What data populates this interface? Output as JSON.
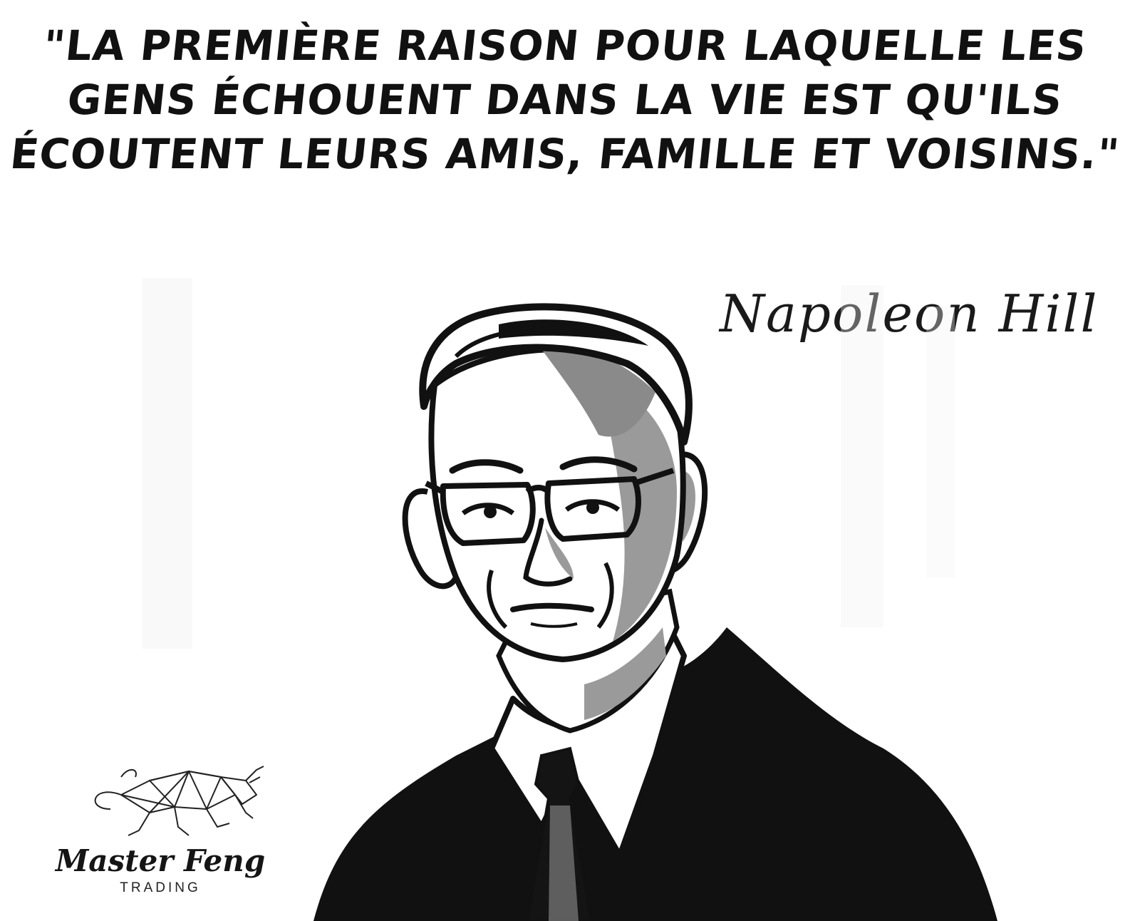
{
  "quote": {
    "lines": [
      "\"LA PREMIÈRE RAISON POUR LAQUELLE LES",
      "GENS ÉCHOUENT DANS LA VIE EST QU'ILS",
      "ÉCOUTENT LEURS AMIS, FAMILLE ET VOISINS.\""
    ]
  },
  "author": "Napoleon Hill",
  "logo": {
    "brand": "Master Feng",
    "subtitle": "TRADING",
    "icon": "bull-icon"
  },
  "portrait": {
    "icon": "portrait-illustration"
  },
  "colors": {
    "background": "#ffffff",
    "ink": "#111111",
    "shade": "#9a9a9a"
  }
}
